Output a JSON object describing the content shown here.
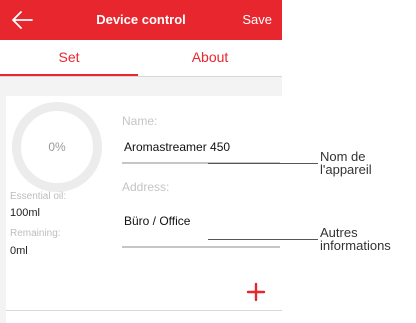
{
  "header": {
    "title": "Device control",
    "save_label": "Save"
  },
  "tabs": [
    {
      "label": "Set",
      "active": true
    },
    {
      "label": "About",
      "active": false
    }
  ],
  "left_panel": {
    "progress_text": "0%",
    "progress_fraction": 0,
    "essential_oil_label": "Essential oil:",
    "essential_oil_value": "100ml",
    "remaining_label": "Remaining:",
    "remaining_value": "0ml"
  },
  "form": {
    "name_label": "Name:",
    "name_value": "Aromastreamer 450",
    "address_label": "Address:",
    "address_value": "Büro / Office"
  },
  "annotations": {
    "name": [
      "Nom de",
      "l'appareil"
    ],
    "info": [
      "Autres",
      "informations"
    ]
  },
  "colors": {
    "accent": "#e8262e"
  },
  "icons": {
    "back": "back-arrow-icon",
    "add": "plus-icon"
  }
}
